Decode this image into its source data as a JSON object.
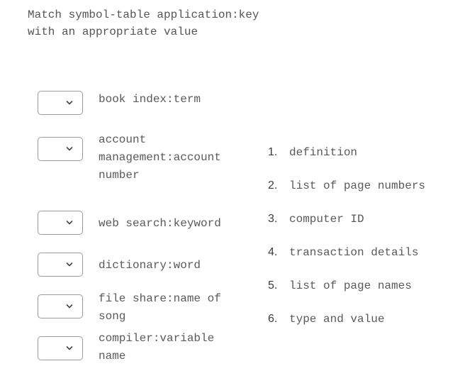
{
  "prompt": {
    "lines": [
      "Match symbol-table application:key",
      "with an appropriate value"
    ]
  },
  "matches": [
    {
      "selected": "",
      "key_lines": [
        "book index:term"
      ]
    },
    {
      "selected": "",
      "key_lines": [
        "account",
        "management:account",
        "number"
      ]
    },
    {
      "selected": "",
      "key_lines": [
        "web search:keyword"
      ]
    },
    {
      "selected": "",
      "key_lines": [
        "dictionary:word"
      ]
    },
    {
      "selected": "",
      "key_lines": [
        "file share:name of",
        "song"
      ]
    },
    {
      "selected": "",
      "key_lines": [
        "compiler:variable",
        "name"
      ]
    }
  ],
  "values": [
    {
      "number": "1.",
      "label": "definition"
    },
    {
      "number": "2.",
      "label": "list of page numbers"
    },
    {
      "number": "3.",
      "label": "computer ID"
    },
    {
      "number": "4.",
      "label": "transaction details"
    },
    {
      "number": "5.",
      "label": "list of page names"
    },
    {
      "number": "6.",
      "label": "type and value"
    }
  ],
  "icons": {
    "dropdown": "chevron-down-icon"
  }
}
